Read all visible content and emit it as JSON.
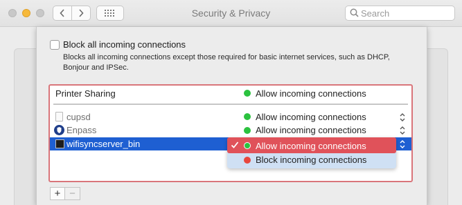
{
  "window": {
    "title": "Security & Privacy",
    "search": {
      "placeholder": "Search",
      "value": "",
      "icon": "search-icon"
    }
  },
  "toolbar": {
    "back_icon": "chevron-left-icon",
    "forward_icon": "chevron-right-icon",
    "show_all_icon": "grid-icon"
  },
  "block_all": {
    "checked": false,
    "label": "Block all incoming connections",
    "description": "Blocks all incoming connections except those required for basic internet services, such as DHCP, Bonjour and IPSec."
  },
  "services": [
    {
      "name": "Printer Sharing",
      "status": "Allow incoming connections",
      "status_color": "#2bc23f"
    }
  ],
  "apps": [
    {
      "name": "cupsd",
      "icon": "file-icon",
      "status": "Allow incoming connections",
      "status_color": "#2bc23f",
      "dimmed": true
    },
    {
      "name": "Enpass",
      "icon": "enpass-icon",
      "status": "Allow incoming connections",
      "status_color": "#2bc23f",
      "dimmed": true
    },
    {
      "name": "wifisyncserver_bin",
      "icon": "terminal-icon",
      "selected": true
    }
  ],
  "popup_menu": {
    "options": [
      {
        "label": "Allow incoming connections",
        "color": "#2bc23f",
        "checked": true
      },
      {
        "label": "Block incoming connections",
        "color": "#e8473e",
        "checked": false
      }
    ]
  },
  "list_buttons": {
    "add": "+",
    "remove": "−"
  },
  "colors": {
    "selection": "#1e5fd2",
    "highlight_border": "#d9757a",
    "menu_selected": "#e0525a"
  }
}
